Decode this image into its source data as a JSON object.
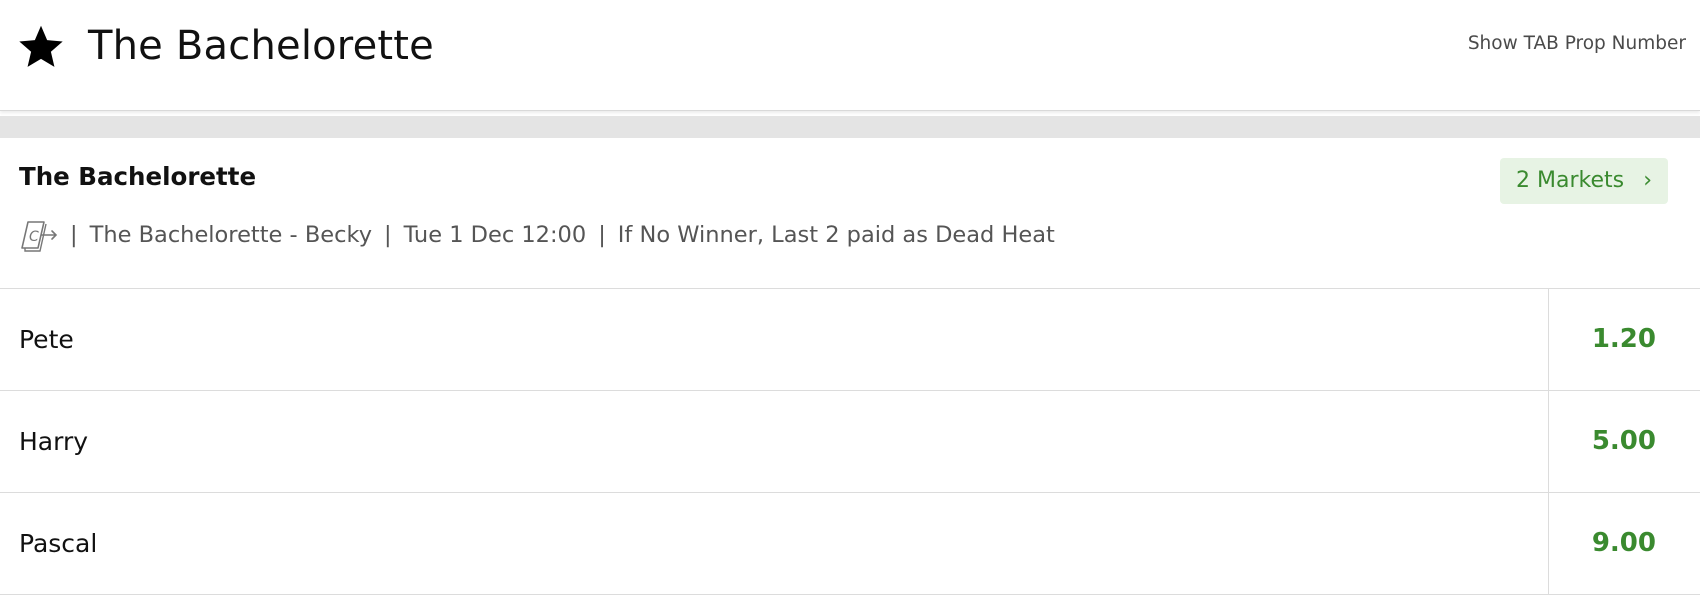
{
  "header": {
    "title": "The Bachelorette",
    "star_icon": "star-icon",
    "show_tab_label": "Show TAB Prop Number"
  },
  "event": {
    "name": "The Bachelorette",
    "markets_label": "2 Markets",
    "markets_chevron": "›",
    "cashout_icon": "cashout-icon",
    "meta": {
      "subtitle": "The Bachelorette - Becky",
      "datetime": "Tue 1 Dec 12:00",
      "rule": "If No Winner, Last 2 paid as Dead Heat",
      "separator": "|"
    }
  },
  "runners": [
    {
      "name": "Pete",
      "odds": "1.20"
    },
    {
      "name": "Harry",
      "odds": "5.00"
    },
    {
      "name": "Pascal",
      "odds": "9.00"
    }
  ],
  "colors": {
    "accent_green": "#3a8a2f",
    "markets_bg": "#e7f3e4",
    "band_grey": "#e4e4e4"
  }
}
